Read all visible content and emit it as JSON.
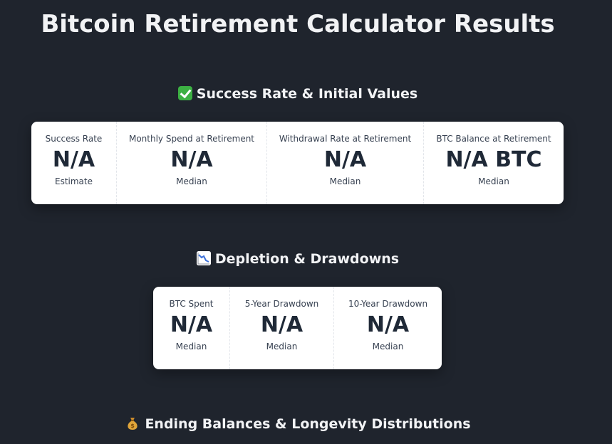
{
  "page": {
    "title": "Bitcoin Retirement Calculator Results"
  },
  "sections": [
    {
      "icon": "check-mark-icon",
      "title": "Success Rate & Initial Values",
      "metrics": [
        {
          "label": "Success Rate",
          "value": "N/A",
          "sub": "Estimate"
        },
        {
          "label": "Monthly Spend at Retirement",
          "value": "N/A",
          "sub": "Median"
        },
        {
          "label": "Withdrawal Rate at Retirement",
          "value": "N/A",
          "sub": "Median"
        },
        {
          "label": "BTC Balance at Retirement",
          "value": "N/A BTC",
          "sub": "Median"
        }
      ]
    },
    {
      "icon": "chart-decreasing-icon",
      "title": "Depletion & Drawdowns",
      "metrics": [
        {
          "label": "BTC Spent",
          "value": "N/A",
          "sub": "Median"
        },
        {
          "label": "5-Year Drawdown",
          "value": "N/A",
          "sub": "Median"
        },
        {
          "label": "10-Year Drawdown",
          "value": "N/A",
          "sub": "Median"
        }
      ]
    },
    {
      "icon": "money-bag-icon",
      "title": "Ending Balances & Longevity Distributions",
      "metrics": []
    }
  ],
  "colors": {
    "background": "#1f242d",
    "card": "#ffffff",
    "text_dark": "#1f2937",
    "heading": "#f2f3f5"
  }
}
